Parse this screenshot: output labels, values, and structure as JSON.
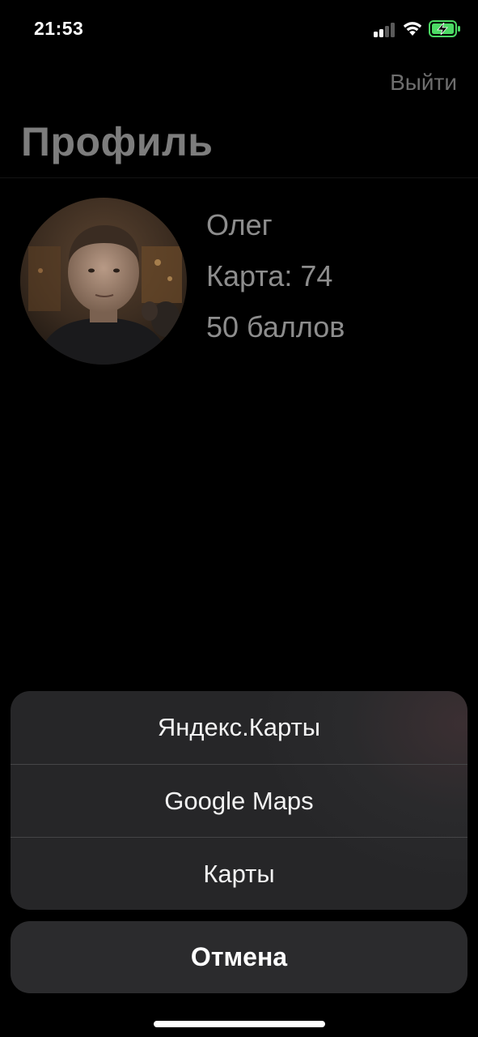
{
  "status_bar": {
    "time": "21:53",
    "icons": [
      "cellular-signal-icon",
      "wifi-icon",
      "battery-charging-icon"
    ],
    "battery_color": "#4cd964"
  },
  "nav": {
    "logout_label": "Выйти"
  },
  "page": {
    "title": "Профиль"
  },
  "profile": {
    "name": "Олег",
    "card": "Карта: 74",
    "points": "50 баллов",
    "avatar": "user-photo"
  },
  "action_sheet": {
    "items": [
      {
        "label": "Яндекс.Карты"
      },
      {
        "label": "Google Maps"
      },
      {
        "label": "Карты"
      }
    ],
    "cancel_label": "Отмена"
  },
  "colors": {
    "background": "#000000",
    "sheet_background": "#2a2a2c",
    "sheet_text": "#f2f2f2",
    "dimmed_text": "#8d8d8d"
  }
}
